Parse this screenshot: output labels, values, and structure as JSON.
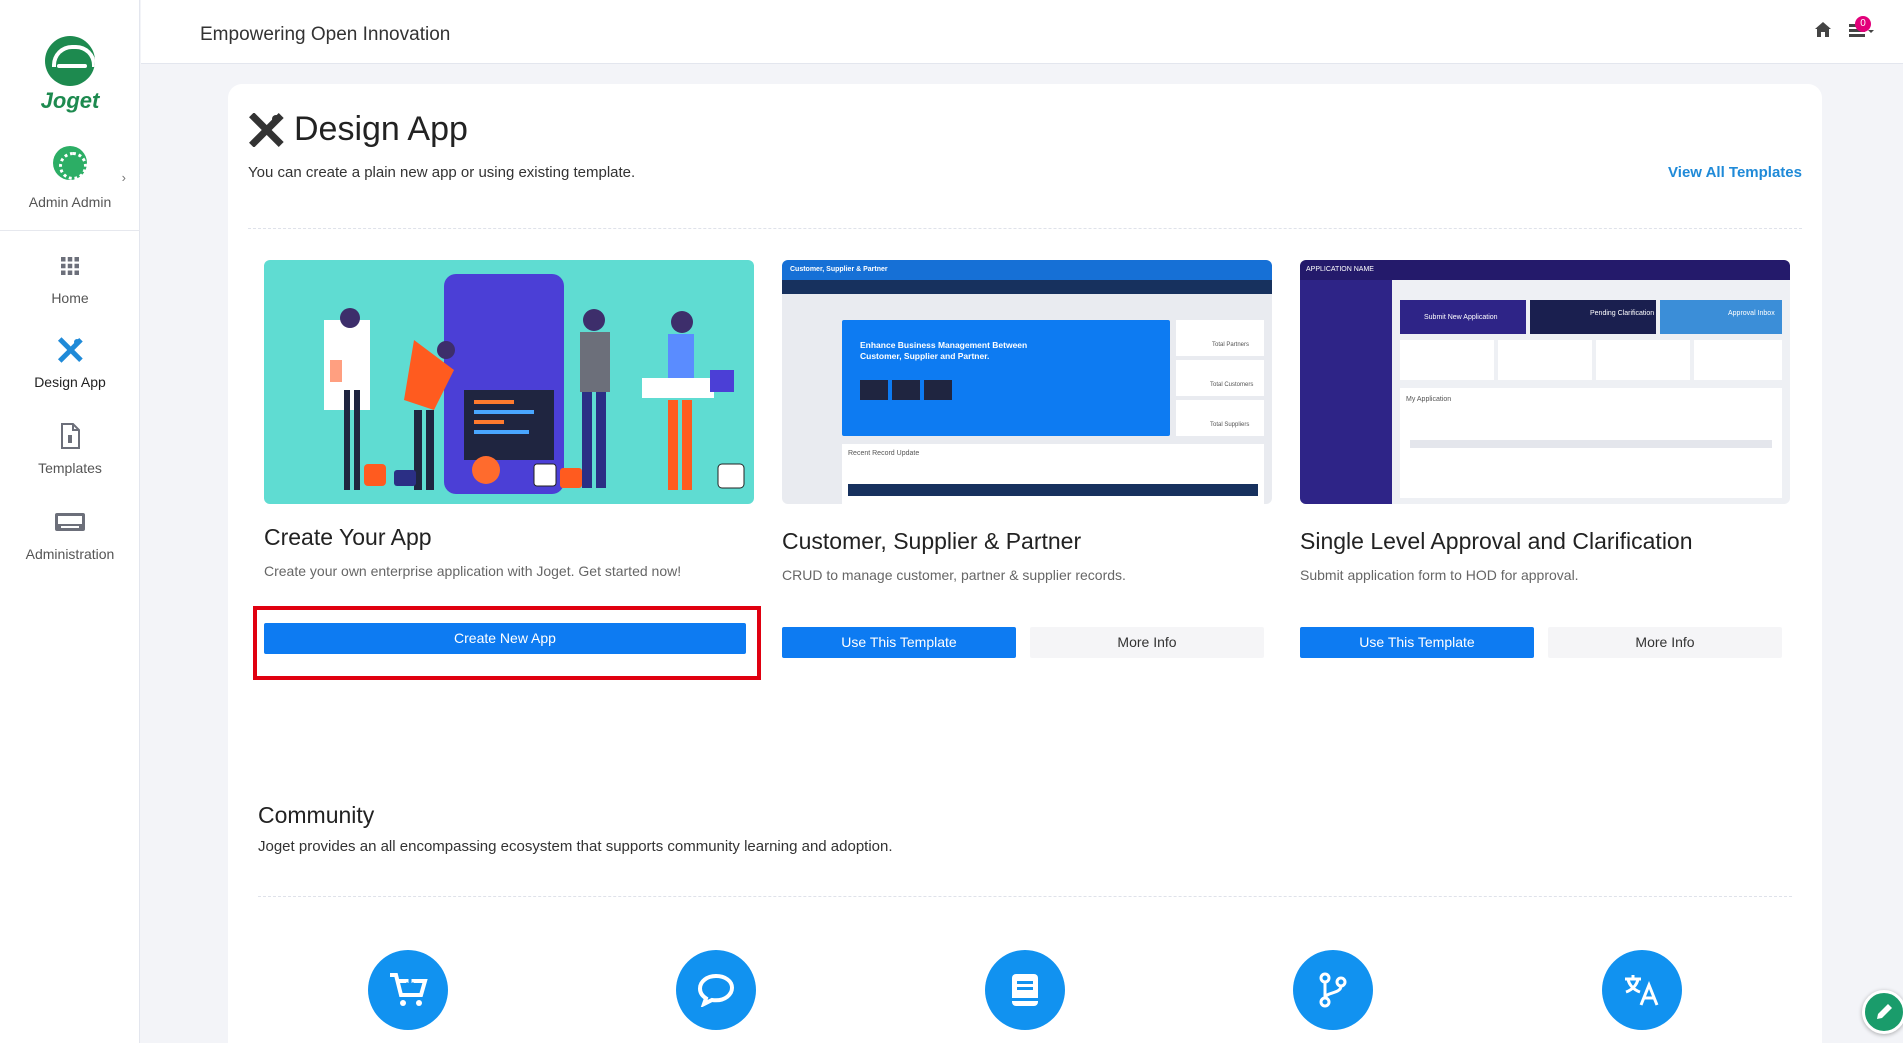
{
  "sidebar": {
    "logo_text": "Joget",
    "user_name": "Admin Admin",
    "items": [
      {
        "label": "Home",
        "icon": "grid-icon"
      },
      {
        "label": "Design App",
        "icon": "design-tools-icon"
      },
      {
        "label": "Templates",
        "icon": "document-icon"
      },
      {
        "label": "Administration",
        "icon": "console-icon"
      }
    ]
  },
  "header": {
    "title": "Empowering Open Innovation",
    "inbox_count": "0"
  },
  "main": {
    "title": "Design App",
    "description": "You can create a plain new app or using existing template.",
    "view_all_label": "View All Templates",
    "templates": [
      {
        "name": "Create Your App",
        "description": "Create your own enterprise application with Joget. Get started now!",
        "primary_label": "Create New App"
      },
      {
        "name": "Customer, Supplier & Partner",
        "description": "CRUD to manage customer, partner & supplier records.",
        "primary_label": "Use This Template",
        "secondary_label": "More Info",
        "preview": {
          "header": "Customer, Supplier & Partner",
          "banner_line1": "Enhance Business Management Between",
          "banner_line2": "Customer, Supplier and Partner.",
          "stat1": "Total Partners",
          "stat2": "Total Customers",
          "stat3": "Total Suppliers",
          "section": "Recent Record Update"
        }
      },
      {
        "name": "Single Level Approval and Clarification",
        "description": "Submit application form to HOD for approval.",
        "primary_label": "Use This Template",
        "secondary_label": "More Info",
        "preview": {
          "header": "APPLICATION NAME",
          "tile1": "Submit New Application",
          "tile2": "Pending Clarification",
          "tile3": "Approval Inbox",
          "section": "My Application"
        }
      }
    ]
  },
  "community": {
    "title": "Community",
    "description": "Joget provides an all encompassing ecosystem that supports community learning and adoption.",
    "icons": [
      "cart-download-icon",
      "chat-icon",
      "book-icon",
      "git-branch-icon",
      "translate-icon"
    ]
  },
  "colors": {
    "primary": "#0d7bf2",
    "link": "#1f8ad8",
    "brand_green": "#1d8a4f",
    "highlight_red": "#e00010",
    "community_blue": "#1192f0"
  }
}
